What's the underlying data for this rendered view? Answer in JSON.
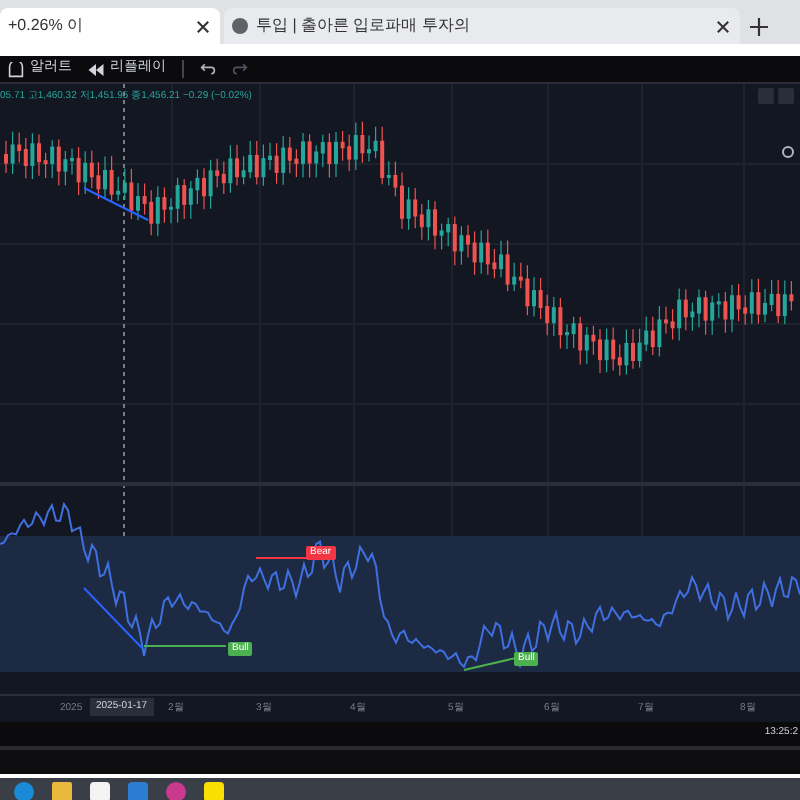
{
  "browser_tabs": [
    {
      "title": "+0.26% 이",
      "selected": true
    },
    {
      "title": "투입 | 출아른 입로파매 투자의",
      "selected": false
    }
  ],
  "toolbar": {
    "alert": "알러트",
    "replay": "리플레이"
  },
  "legend": "05.71 고1,460.32 저1,451.95 종1,456.21 −0.29 (−0.02%)",
  "signals": [
    {
      "kind": "bear",
      "label": "Bear"
    },
    {
      "kind": "bull",
      "label": "Bull"
    },
    {
      "kind": "bull",
      "label": "Bull"
    }
  ],
  "time_axis": {
    "year": "2025",
    "cursor_date": "2025-01-17",
    "months": [
      "2월",
      "3월",
      "4월",
      "5월",
      "6월",
      "7월",
      "8월"
    ]
  },
  "clock": "13:25:2"
}
